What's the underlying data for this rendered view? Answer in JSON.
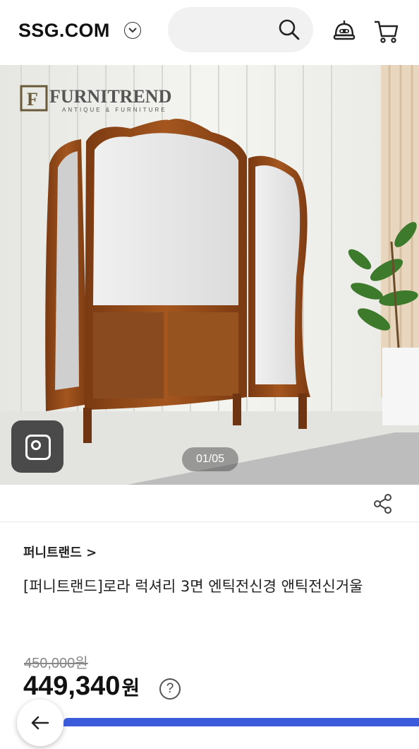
{
  "header": {
    "logo_text": "SSG.COM",
    "search_placeholder": ""
  },
  "hero": {
    "brand_logo_text": "FURNITREND",
    "brand_logo_sub": "ANTIQUE & FURNITURE",
    "image_counter": "01/05"
  },
  "product": {
    "brand_link": "퍼니트랜드 >",
    "title": "[퍼니트랜드]로라 럭셔리 3면 엔틱전신경 앤틱전신거울",
    "original_price": "450,000원",
    "sale_price": "449,340",
    "sale_price_unit": "원",
    "help_glyph": "?"
  },
  "colors": {
    "accent": "#3b5bdb",
    "wall": "#efefec",
    "wood": "#7a3f17"
  }
}
